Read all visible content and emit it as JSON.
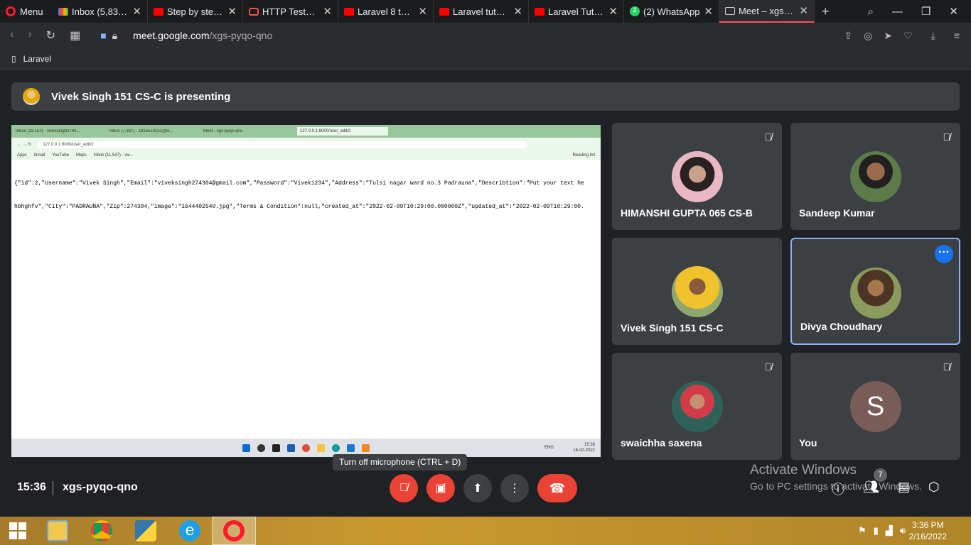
{
  "browser": {
    "menu_label": "Menu",
    "tabs": [
      {
        "title": "Inbox (5,839) -",
        "icon": "gmail-icon"
      },
      {
        "title": "Step by step le",
        "icon": "youtube-icon"
      },
      {
        "title": "HTTP Tests - La",
        "icon": "laravel-icon"
      },
      {
        "title": "Laravel 8 tutori",
        "icon": "youtube-icon"
      },
      {
        "title": "Laravel tutorial",
        "icon": "youtube-icon"
      },
      {
        "title": "Laravel Tutorial",
        "icon": "youtube-icon"
      },
      {
        "title": "(2) WhatsApp",
        "icon": "whatsapp-icon",
        "badge": "2"
      },
      {
        "title": "Meet – xgs-pyc",
        "icon": "meet-icon",
        "active": true
      }
    ],
    "url_domain": "meet.google.com",
    "url_path": "/xgs-pyqo-qno",
    "bookmark": "Laravel"
  },
  "meet": {
    "presenting_text": "Vivek Singh 151 CS-C is presenting",
    "shared_screen": {
      "tabs": [
        "Inbox (13,152) - viveksingh2743...",
        "Inbox (7,337) - 1816510151@ki...",
        "Meet - xgs-pyqo-qno",
        "127.0.0.1:8000/user_edit/2"
      ],
      "url": "127.0.0.1:8000/user_edit/2",
      "bookmarks": [
        "Apps",
        "Gmail",
        "YouTube",
        "Maps",
        "Inbox (11,547) - viv..."
      ],
      "reading_list": "Reading list",
      "json_line1": "{\"id\":2,\"Username\":\"Vivek Singh\",\"Email\":\"viveksingh274304@gmail.com\",\"Password\":\"Vivek1234\",\"Address\":\"Tulsi nagar ward no.3 Padrauna\",\"Describtion\":\"Put your text he",
      "json_line2": "hbhghfv\",\"City\":\"PADRAUNA\",\"Zip\":274304,\"image\":\"1644402540.jpg\",\"Terms & Condition\":null,\"created_at\":\"2022-02-09T10:29:00.000000Z\",\"updated_at\":\"2022-02-09T10:29:00.",
      "tray_time": "15:36",
      "tray_date": "16-02-2022",
      "tray_lang": "ENG"
    },
    "participants": [
      {
        "name": "HIMANSHI GUPTA 065 CS-B",
        "muted": true
      },
      {
        "name": "Sandeep Kumar",
        "muted": true
      },
      {
        "name": "Vivek Singh 151 CS-C",
        "muted": false
      },
      {
        "name": "Divya Choudhary",
        "muted": false,
        "highlighted": true
      },
      {
        "name": "swaichha saxena",
        "muted": true
      },
      {
        "name": "You",
        "muted": true,
        "initial": "S"
      }
    ],
    "tooltip": "Turn off microphone (CTRL + D)",
    "time": "15:36",
    "meeting_code": "xgs-pyqo-qno",
    "people_count": "7"
  },
  "activate_windows": {
    "line1": "Activate Windows",
    "line2": "Go to PC settings to activate Windows."
  },
  "taskbar": {
    "time": "3:36 PM",
    "date": "2/16/2022"
  }
}
